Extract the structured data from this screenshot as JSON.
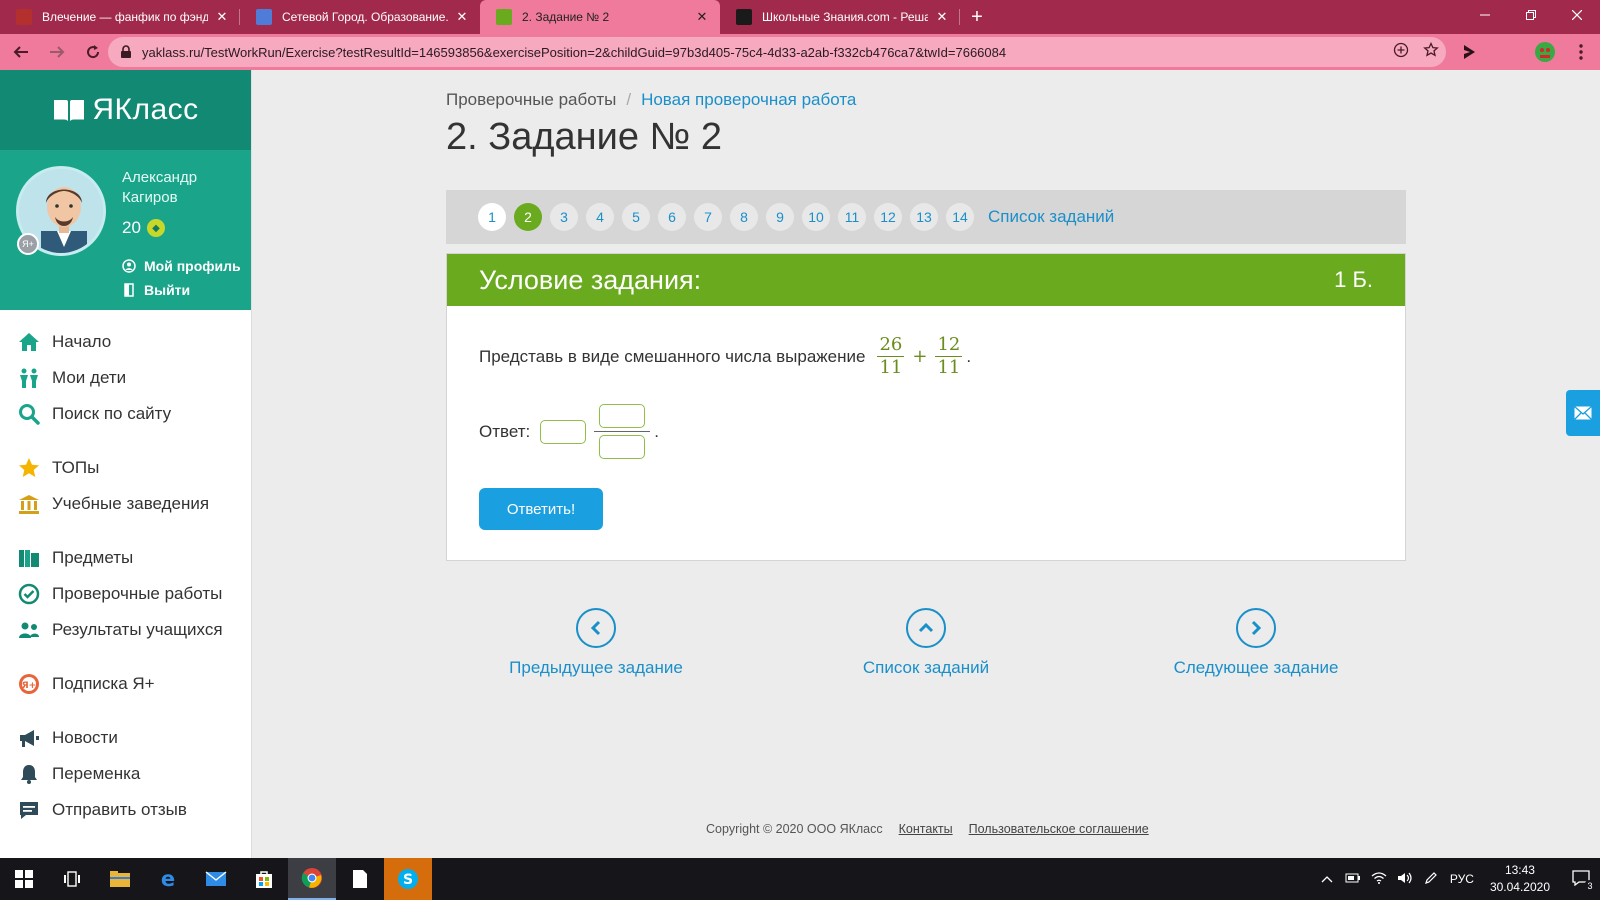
{
  "browser": {
    "tabs": [
      {
        "title": "Влечение — фанфик по фэндом",
        "favicon_color": "#b3302f"
      },
      {
        "title": "Сетевой Город. Образование. Д",
        "favicon_color": "#4f7cd6"
      },
      {
        "title": "2. Задание № 2",
        "favicon_color": "#6aaa1e"
      },
      {
        "title": "Школьные Знания.com - Решае",
        "favicon_color": "#1a1a1a"
      }
    ],
    "active_tab_index": 2,
    "close_glyph": "✕",
    "new_tab_glyph": "+",
    "url": "yaklass.ru/TestWorkRun/Exercise?testResultId=146593856&exercisePosition=2&childGuid=97b3d405-75c4-4d33-a2ab-f332cb476ca7&twId=7666084"
  },
  "site": {
    "logo_text": "ЯКласс",
    "user": {
      "name_line1": "Александр",
      "name_line2": "Кагиров",
      "points": "20"
    },
    "profile_link": "Мой профиль",
    "logout_link": "Выйти",
    "nav": [
      {
        "label": "Начало",
        "icon": "home-icon",
        "group": 1
      },
      {
        "label": "Мои дети",
        "icon": "children-icon",
        "group": 1
      },
      {
        "label": "Поиск по сайту",
        "icon": "search-icon",
        "group": 1
      },
      {
        "label": "ТОПы",
        "icon": "star-icon",
        "group": 2
      },
      {
        "label": "Учебные заведения",
        "icon": "institution-icon",
        "group": 2
      },
      {
        "label": "Предметы",
        "icon": "books-icon",
        "group": 3
      },
      {
        "label": "Проверочные работы",
        "icon": "check-circle-icon",
        "group": 3
      },
      {
        "label": "Результаты учащихся",
        "icon": "students-icon",
        "group": 3
      },
      {
        "label": "Подписка Я+",
        "icon": "subscription-icon",
        "group": 4
      },
      {
        "label": "Новости",
        "icon": "megaphone-icon",
        "group": 5
      },
      {
        "label": "Переменка",
        "icon": "bell-icon",
        "group": 5
      },
      {
        "label": "Отправить отзыв",
        "icon": "feedback-icon",
        "group": 5
      }
    ]
  },
  "main": {
    "breadcrumb": {
      "root": "Проверочные работы",
      "separator": "/",
      "current": "Новая проверочная работа"
    },
    "title": "2. Задание № 2",
    "pager": {
      "pages": [
        "1",
        "2",
        "3",
        "4",
        "5",
        "6",
        "7",
        "8",
        "9",
        "10",
        "11",
        "12",
        "13",
        "14"
      ],
      "current_index": 1,
      "list_label": "Список заданий"
    },
    "card": {
      "header": "Условие задания:",
      "points": "1 Б.",
      "task_text": "Представь в виде смешанного числа выражение",
      "fraction1": {
        "num": "26",
        "den": "11"
      },
      "operator": "+",
      "fraction2": {
        "num": "12",
        "den": "11"
      },
      "task_end": ".",
      "answer_label": "Ответ:",
      "answer_end": ".",
      "submit_label": "Ответить!"
    },
    "nav_buttons": {
      "prev": "Предыдущее задание",
      "list": "Список заданий",
      "next": "Следующее задание"
    },
    "footer": {
      "copyright": "Copyright © 2020 ООО ЯКласс",
      "contacts": "Контакты",
      "agreement": "Пользовательское соглашение"
    }
  },
  "taskbar": {
    "lang": "РУС",
    "time": "13:43",
    "date": "30.04.2020",
    "notifications": "3"
  },
  "colors": {
    "brand_green": "#1aa58a",
    "accent_green": "#6aaa1e",
    "link_blue": "#1a8fc9",
    "button_blue": "#1aa0e0",
    "tabbar": "#a12a4c"
  }
}
